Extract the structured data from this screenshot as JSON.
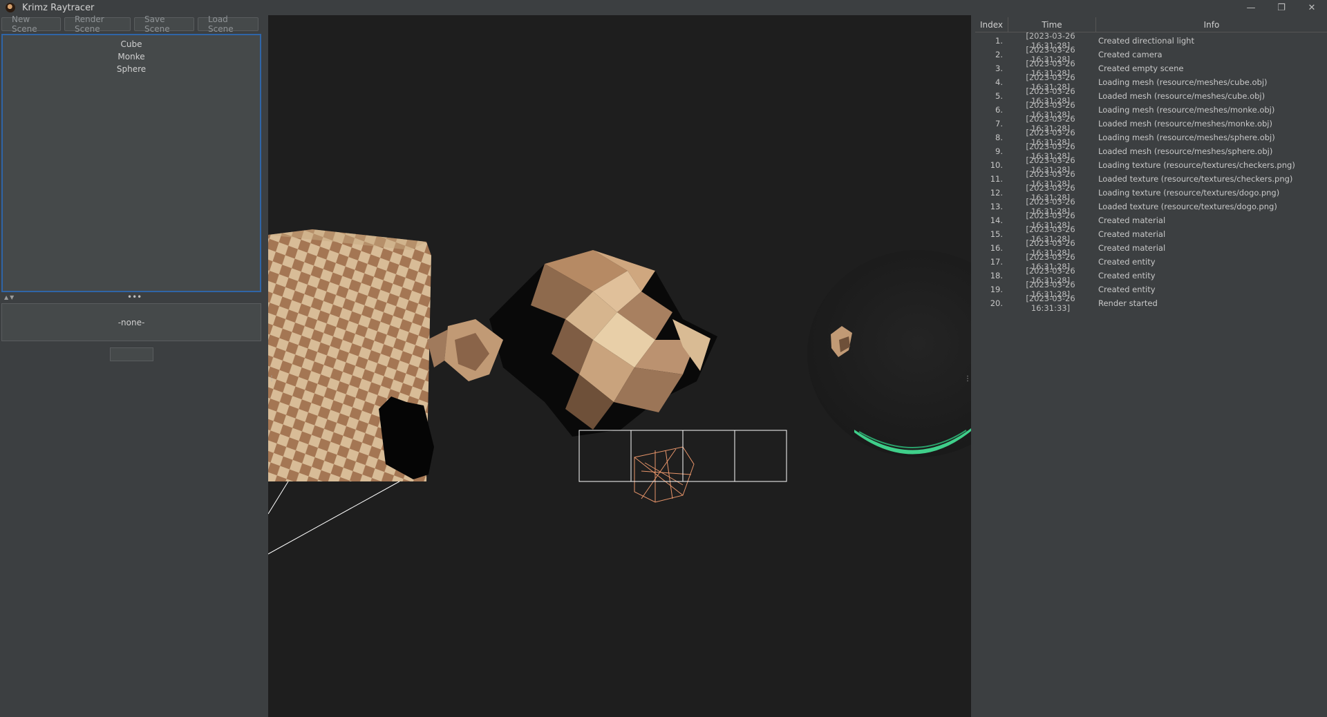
{
  "window": {
    "title": "Krimz Raytracer",
    "controls": [
      "—",
      "❐",
      "✕"
    ]
  },
  "toolbar": {
    "new_scene": "New Scene",
    "render_scene": "Render Scene",
    "save_scene": "Save Scene",
    "load_scene": "Load Scene"
  },
  "scene_list": {
    "items": [
      "Cube",
      "Monke",
      "Sphere"
    ]
  },
  "splitter": {
    "arrows": "▲▼",
    "dots": "•••"
  },
  "properties": {
    "selected": "-none-"
  },
  "log": {
    "headers": {
      "index": "Index",
      "time": "Time",
      "info": "Info"
    },
    "rows": [
      {
        "index": "1.",
        "time": "[2023-03-26 16:31:28]",
        "info": "Created directional light"
      },
      {
        "index": "2.",
        "time": "[2023-03-26 16:31:28]",
        "info": "Created camera"
      },
      {
        "index": "3.",
        "time": "[2023-03-26 16:31:28]",
        "info": "Created empty scene"
      },
      {
        "index": "4.",
        "time": "[2023-03-26 16:31:28]",
        "info": "Loading mesh (resource/meshes/cube.obj)"
      },
      {
        "index": "5.",
        "time": "[2023-03-26 16:31:28]",
        "info": "Loaded mesh (resource/meshes/cube.obj)"
      },
      {
        "index": "6.",
        "time": "[2023-03-26 16:31:28]",
        "info": "Loading mesh (resource/meshes/monke.obj)"
      },
      {
        "index": "7.",
        "time": "[2023-03-26 16:31:28]",
        "info": "Loaded mesh (resource/meshes/monke.obj)"
      },
      {
        "index": "8.",
        "time": "[2023-03-26 16:31:28]",
        "info": "Loading mesh (resource/meshes/sphere.obj)"
      },
      {
        "index": "9.",
        "time": "[2023-03-26 16:31:28]",
        "info": "Loaded mesh (resource/meshes/sphere.obj)"
      },
      {
        "index": "10.",
        "time": "[2023-03-26 16:31:28]",
        "info": "Loading texture (resource/textures/checkers.png)"
      },
      {
        "index": "11.",
        "time": "[2023-03-26 16:31:28]",
        "info": "Loaded texture (resource/textures/checkers.png)"
      },
      {
        "index": "12.",
        "time": "[2023-03-26 16:31:28]",
        "info": "Loading texture (resource/textures/dogo.png)"
      },
      {
        "index": "13.",
        "time": "[2023-03-26 16:31:28]",
        "info": "Loaded texture (resource/textures/dogo.png)"
      },
      {
        "index": "14.",
        "time": "[2023-03-26 16:31:28]",
        "info": "Created material"
      },
      {
        "index": "15.",
        "time": "[2023-03-26 16:31:28]",
        "info": "Created material"
      },
      {
        "index": "16.",
        "time": "[2023-03-26 16:31:28]",
        "info": "Created material"
      },
      {
        "index": "17.",
        "time": "[2023-03-26 16:31:28]",
        "info": "Created entity"
      },
      {
        "index": "18.",
        "time": "[2023-03-26 16:31:28]",
        "info": "Created entity"
      },
      {
        "index": "19.",
        "time": "[2023-03-26 16:31:28]",
        "info": "Created entity"
      },
      {
        "index": "20.",
        "time": "[2023-03-26 16:31:33]",
        "info": "Render started"
      }
    ]
  },
  "colors": {
    "accent": "#2f65a7",
    "checker_light": "#d8bc97",
    "checker_dark": "#a47653",
    "wire_orange": "#e8956a",
    "wire_green": "#3fcf8a"
  },
  "icons": {
    "app": "raytracer-app-icon",
    "minimize": "minimize-icon",
    "restore": "restore-icon",
    "close": "close-icon"
  }
}
